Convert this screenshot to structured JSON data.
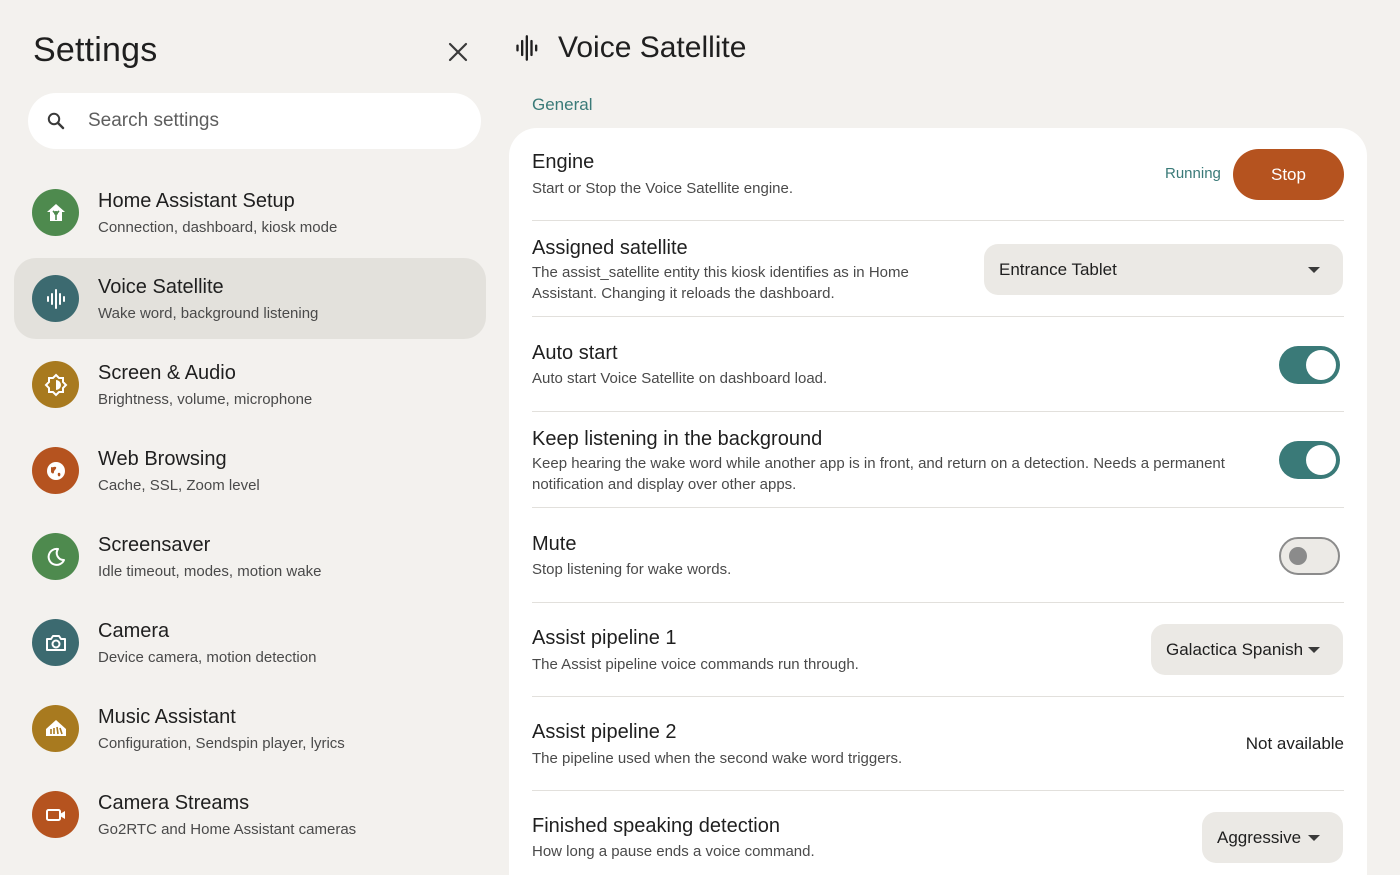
{
  "sidebar": {
    "title": "Settings",
    "search": {
      "placeholder": "Search settings",
      "value": ""
    },
    "items": [
      {
        "label": "Home Assistant Setup",
        "sub": "Connection, dashboard, kiosk mode",
        "color": "#4e8a4e",
        "icon": "home-assistant-icon"
      },
      {
        "label": "Voice Satellite",
        "sub": "Wake word, background listening",
        "color": "#3c6a70",
        "icon": "waveform-icon"
      },
      {
        "label": "Screen & Audio",
        "sub": "Brightness, volume, microphone",
        "color": "#a87a1f",
        "icon": "brightness-icon"
      },
      {
        "label": "Web Browsing",
        "sub": "Cache, SSL, Zoom level",
        "color": "#b5531f",
        "icon": "globe-icon"
      },
      {
        "label": "Screensaver",
        "sub": "Idle timeout, modes, motion wake",
        "color": "#4e8a4e",
        "icon": "moon-icon"
      },
      {
        "label": "Camera",
        "sub": "Device camera, motion detection",
        "color": "#3c6a70",
        "icon": "camera-icon"
      },
      {
        "label": "Music Assistant",
        "sub": "Configuration, Sendspin player, lyrics",
        "color": "#a87a1f",
        "icon": "music-assistant-icon"
      },
      {
        "label": "Camera Streams",
        "sub": "Go2RTC and Home Assistant cameras",
        "color": "#b5531f",
        "icon": "video-camera-icon"
      }
    ]
  },
  "header": {
    "title": "Voice Satellite",
    "icon": "waveform-icon"
  },
  "section": {
    "label": "General"
  },
  "settings": {
    "engine": {
      "title": "Engine",
      "desc": "Start or Stop the Voice Satellite engine.",
      "status": "Running",
      "button": "Stop"
    },
    "assigned": {
      "title": "Assigned satellite",
      "desc": "The assist_satellite entity this kiosk identifies as in Home Assistant. Changing it reloads the dashboard.",
      "value": "Entrance Tablet"
    },
    "autostart": {
      "title": "Auto start",
      "desc": "Auto start Voice Satellite on dashboard load.",
      "enabled": true
    },
    "background": {
      "title": "Keep listening in the background",
      "desc": "Keep hearing the wake word while another app is in front, and return on a detection. Needs a permanent notification and display over other apps.",
      "enabled": true
    },
    "mute": {
      "title": "Mute",
      "desc": "Stop listening for wake words.",
      "enabled": false
    },
    "pipeline1": {
      "title": "Assist pipeline 1",
      "desc": "The Assist pipeline voice commands run through.",
      "value": "Galactica Spanish"
    },
    "pipeline2": {
      "title": "Assist pipeline 2",
      "desc": "The pipeline used when the second wake word triggers.",
      "value": "Not available"
    },
    "finished": {
      "title": "Finished speaking detection",
      "desc": "How long a pause ends a voice command.",
      "value": "Aggressive"
    }
  },
  "colors": {
    "accent": "#3a7a78",
    "stop": "#b5531f",
    "background": "#f3f1ee"
  }
}
